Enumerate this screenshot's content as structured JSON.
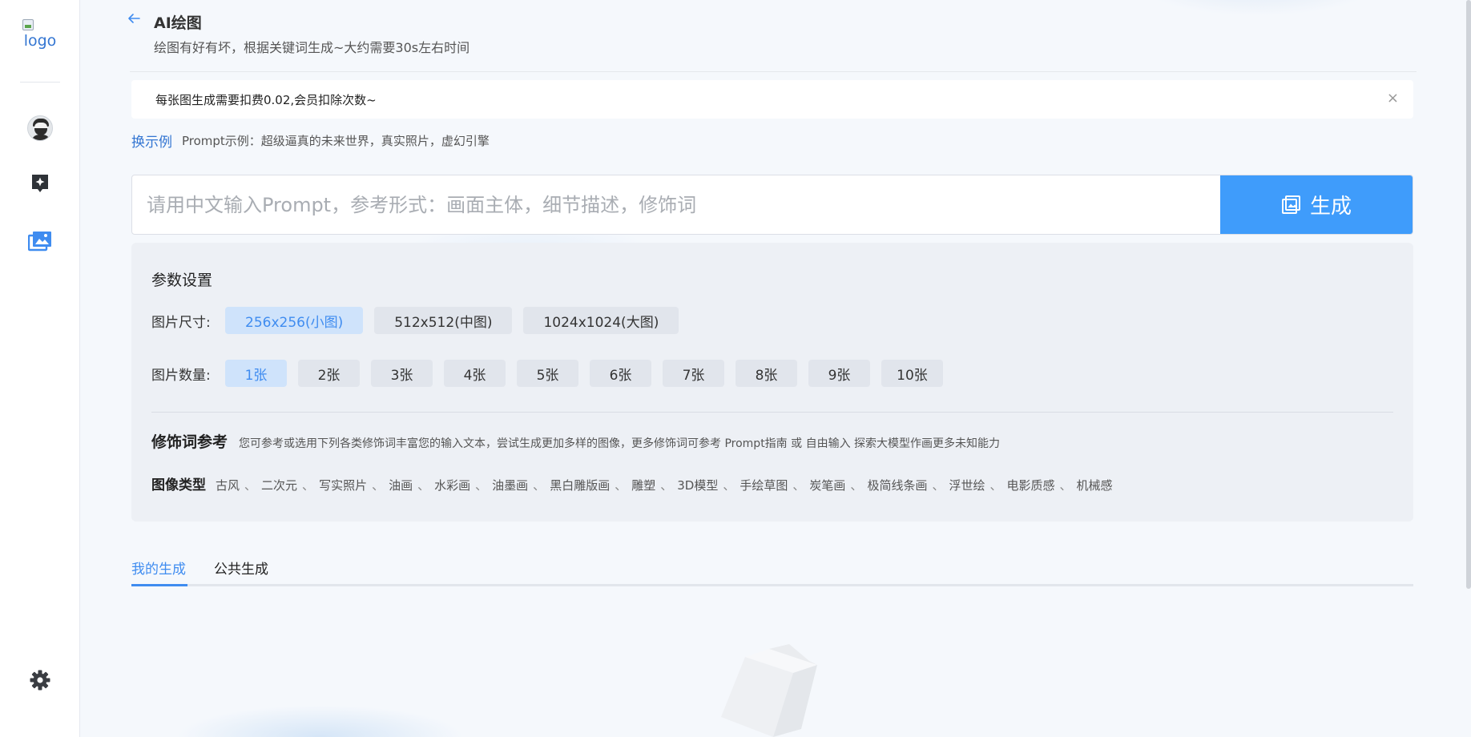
{
  "sidebar": {
    "logo_alt": "logo",
    "items": [
      {
        "name": "avatar",
        "icon": "user-avatar"
      },
      {
        "name": "ai-chat",
        "icon": "sparkle-chat-icon"
      },
      {
        "name": "ai-drawing",
        "icon": "image-gallery-icon",
        "active_color": "#3f8cf0"
      },
      {
        "name": "settings",
        "icon": "gear-icon"
      }
    ]
  },
  "header": {
    "title": "AI绘图",
    "subtitle": "绘图有好有坏，根据关键词生成~大约需要30s左右时间"
  },
  "notice": {
    "text": "每张图生成需要扣费0.02,会员扣除次数~",
    "close": "×"
  },
  "example": {
    "link_label": "换示例",
    "text": "Prompt示例：超级逼真的未来世界，真实照片，虚幻引擎"
  },
  "prompt": {
    "placeholder": "请用中文输入Prompt，参考形式：画面主体，细节描述，修饰词",
    "value": "",
    "generate_label": "生成"
  },
  "params": {
    "title": "参数设置",
    "size": {
      "label": "图片尺寸:",
      "options": [
        "256x256(小图)",
        "512x512(中图)",
        "1024x1024(大图)"
      ],
      "selected": 0
    },
    "count": {
      "label": "图片数量:",
      "options": [
        "1张",
        "2张",
        "3张",
        "4张",
        "5张",
        "6张",
        "7张",
        "8张",
        "9张",
        "10张"
      ],
      "selected": 0
    },
    "modifier": {
      "title": "修饰词参考",
      "desc": "您可参考或选用下列各类修饰词丰富您的输入文本，尝试生成更加多样的图像，更多修饰词可参考 Prompt指南 或 自由输入 探索大模型作画更多未知能力"
    },
    "image_type": {
      "title": "图像类型",
      "items": [
        "古风",
        "二次元",
        "写实照片",
        "油画",
        "水彩画",
        "油墨画",
        "黑白雕版画",
        "雕塑",
        "3D模型",
        "手绘草图",
        "炭笔画",
        "极简线条画",
        "浮世绘",
        "电影质感",
        "机械感"
      ],
      "separator": "、"
    }
  },
  "tabs": [
    {
      "label": "我的生成",
      "active": true
    },
    {
      "label": "公共生成",
      "active": false
    }
  ],
  "colors": {
    "accent": "#3f8cf0",
    "button": "#3f9cfb",
    "panel": "#edf0f5"
  }
}
